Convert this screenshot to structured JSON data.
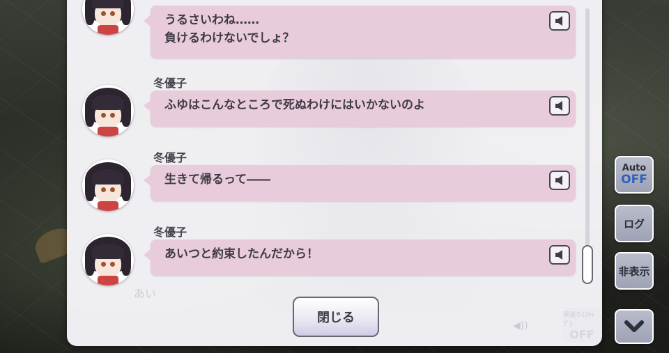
{
  "log": {
    "entries": [
      {
        "speaker": "",
        "text": "うるさいわね……\n負けるわけないでしょ？"
      },
      {
        "speaker": "冬優子",
        "text": "ふゆはこんなところで死ぬわけにはいかないのよ"
      },
      {
        "speaker": "冬優子",
        "text": "生きて帰るって――"
      },
      {
        "speaker": "冬優子",
        "text": "あいつと約束したんだから！"
      }
    ],
    "close_label": "閉じる",
    "background_text": "あい"
  },
  "side": {
    "auto_top": "Auto",
    "auto_bottom": "OFF",
    "log_label": "ログ",
    "hide_label": "非表示",
    "faint_top": "早送り(ｽｷｯﾌﾟ)",
    "faint_bottom": "OFF"
  },
  "icons": [
    "speaker-icon",
    "chevron-down-icon"
  ]
}
